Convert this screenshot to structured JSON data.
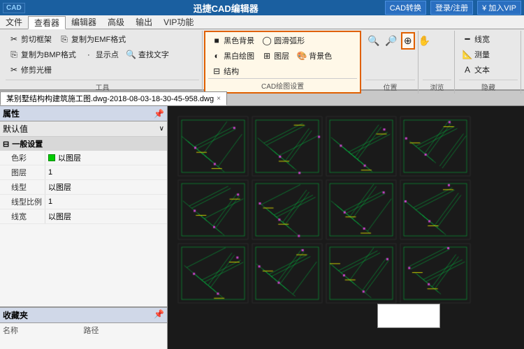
{
  "app": {
    "title": "迅捷CAD编辑器",
    "logo": "CAD",
    "header_btns": [
      "CAD转换",
      "登录/注册",
      "¥ 加入VIP"
    ]
  },
  "menu": {
    "items": [
      "文件",
      "查看器",
      "编辑器",
      "高级",
      "输出",
      "VIP功能"
    ]
  },
  "ribbon": {
    "active_tab": "查看器",
    "groups": [
      {
        "label": "工具",
        "buttons": [
          "剪切框架",
          "复制为EMF格式",
          "复制为BMP格式",
          "显示点",
          "查找文字",
          "修剪光栅"
        ]
      },
      {
        "label": "CAD绘图设置",
        "buttons": [
          "黑色背景",
          "黑白绘图",
          "背景色",
          "圆滑弧形",
          "图层",
          "结构"
        ]
      },
      {
        "label": "位置",
        "buttons": [
          "放大",
          "缩小",
          "适合窗口",
          "实时缩放"
        ]
      },
      {
        "label": "浏览",
        "buttons": []
      },
      {
        "label": "隐藏",
        "buttons": [
          "线宽",
          "测量",
          "文本"
        ]
      }
    ]
  },
  "properties": {
    "title": "属性",
    "default_label": "默认值",
    "section_general": "一般设置",
    "rows": [
      {
        "label": "色彩",
        "value": "以图层",
        "has_color": true
      },
      {
        "label": "图层",
        "value": "1",
        "has_color": false
      },
      {
        "label": "线型",
        "value": "以图层",
        "has_color": false
      },
      {
        "label": "线型比例",
        "value": "1",
        "has_color": false
      },
      {
        "label": "线宽",
        "value": "以图层",
        "has_color": false
      }
    ]
  },
  "favorites": {
    "title": "收藏夹",
    "columns": [
      "名称",
      "路径"
    ]
  },
  "drawing_tab": {
    "filename": "某别墅结构构建筑施工图.dwg-2018-08-03-18-30-45-958.dwg",
    "close_icon": "×"
  }
}
